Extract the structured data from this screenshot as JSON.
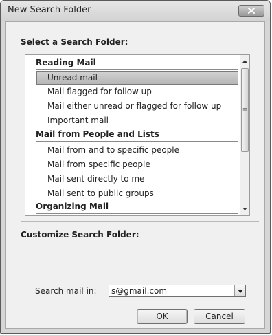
{
  "window": {
    "title": "New Search Folder"
  },
  "select_section": {
    "label": "Select a Search Folder:",
    "groups": [
      {
        "name": "Reading Mail",
        "items": [
          "Unread mail",
          "Mail flagged for follow up",
          "Mail either unread or flagged for follow up",
          "Important mail"
        ]
      },
      {
        "name": "Mail from People and Lists",
        "items": [
          "Mail from and to specific people",
          "Mail from specific people",
          "Mail sent directly to me",
          "Mail sent to public groups"
        ]
      },
      {
        "name": "Organizing Mail",
        "items": []
      }
    ],
    "selected_item": "Unread mail"
  },
  "customize_section": {
    "label": "Customize Search Folder:"
  },
  "search_in": {
    "label": "Search mail in:",
    "value": "s@gmail.com"
  },
  "buttons": {
    "ok": "OK",
    "cancel": "Cancel"
  },
  "icons": {
    "close": "close-icon",
    "scroll_up": "scroll-up-arrow-icon",
    "scroll_down": "scroll-down-arrow-icon",
    "dropdown": "chevron-down-icon"
  }
}
